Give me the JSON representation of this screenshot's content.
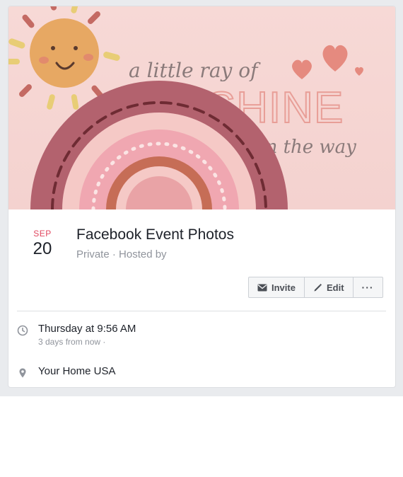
{
  "cover": {
    "line1": "a little ray of",
    "line2": "SUNSHINE",
    "line3": "is on the way"
  },
  "event": {
    "month": "SEP",
    "day": "20",
    "title": "Facebook Event Photos",
    "meta": "Private · Hosted by"
  },
  "actions": {
    "invite_label": "Invite",
    "edit_label": "Edit",
    "more_label": "···"
  },
  "details": {
    "time": "Thursday at 9:56 AM",
    "relative": "3 days from now ·",
    "location": "Your Home USA"
  },
  "colors": {
    "cover_bg": "#f5d5d2",
    "date_red": "#e0465e",
    "sun": "#e7a863",
    "rainbow_outer": "#b3626e"
  },
  "icons": [
    "envelope-icon",
    "pencil-icon",
    "more-icon",
    "clock-icon",
    "location-pin-icon"
  ]
}
